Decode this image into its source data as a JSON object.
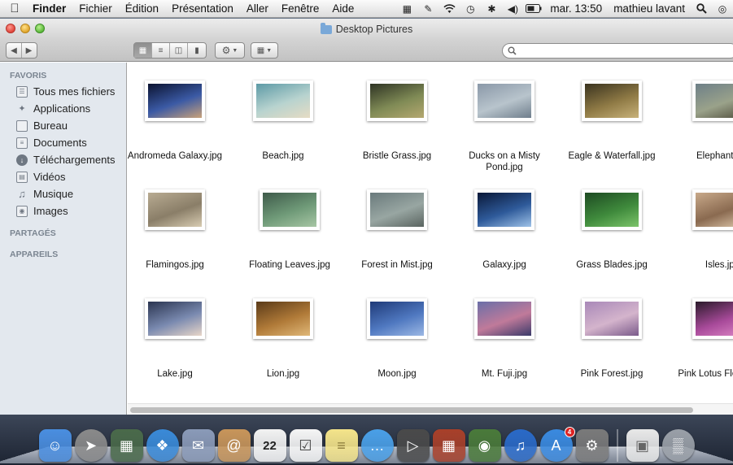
{
  "menubar": {
    "app_name": "Finder",
    "menus": [
      "Fichier",
      "Édition",
      "Présentation",
      "Aller",
      "Fenêtre",
      "Aide"
    ],
    "clock": "mar. 13:50",
    "user": "mathieu lavant",
    "status_icons": [
      "display-icon",
      "script-icon",
      "wifi-icon",
      "time-machine-icon",
      "bluetooth-icon",
      "volume-icon",
      "battery-icon"
    ]
  },
  "window": {
    "title": "Desktop Pictures"
  },
  "search": {
    "placeholder": ""
  },
  "sidebar": {
    "favorites_header": "FAVORIS",
    "favorites": [
      {
        "label": "Tous mes fichiers",
        "icon": "all-files-icon"
      },
      {
        "label": "Applications",
        "icon": "applications-icon"
      },
      {
        "label": "Bureau",
        "icon": "desktop-icon"
      },
      {
        "label": "Documents",
        "icon": "documents-icon"
      },
      {
        "label": "Téléchargements",
        "icon": "downloads-icon"
      },
      {
        "label": "Vidéos",
        "icon": "movies-icon"
      },
      {
        "label": "Musique",
        "icon": "music-icon"
      },
      {
        "label": "Images",
        "icon": "pictures-icon"
      }
    ],
    "shared_header": "PARTAGÉS",
    "devices_header": "APPAREILS"
  },
  "files": [
    {
      "name": "Andromeda Galaxy.jpg",
      "colors": [
        "#0b1330",
        "#3b5aa5",
        "#c9a27a"
      ]
    },
    {
      "name": "Beach.jpg",
      "colors": [
        "#5d9aa6",
        "#b8d3cf",
        "#e6dcc4"
      ]
    },
    {
      "name": "Bristle Grass.jpg",
      "colors": [
        "#2f3424",
        "#7f8a55",
        "#b5a870"
      ]
    },
    {
      "name": "Ducks on a Misty Pond.jpg",
      "colors": [
        "#8a98a8",
        "#b8c4cc",
        "#6f7e8c"
      ]
    },
    {
      "name": "Eagle & Waterfall.jpg",
      "colors": [
        "#3a331f",
        "#8f7a45",
        "#c8b27a"
      ]
    },
    {
      "name": "Elephant.jpg",
      "colors": [
        "#6d7f88",
        "#9aa28a",
        "#4d4a38"
      ]
    },
    {
      "name": "Flamingos.jpg",
      "colors": [
        "#b8ab92",
        "#8a7e68",
        "#d8ccb2"
      ]
    },
    {
      "name": "Floating Leaves.jpg",
      "colors": [
        "#3e5a4a",
        "#6f9a78",
        "#a7c6a4"
      ]
    },
    {
      "name": "Forest in Mist.jpg",
      "colors": [
        "#6a7a7c",
        "#98a6a2",
        "#5a6460"
      ]
    },
    {
      "name": "Galaxy.jpg",
      "colors": [
        "#0a1838",
        "#2e5a9a",
        "#9ec2e8"
      ]
    },
    {
      "name": "Grass Blades.jpg",
      "colors": [
        "#1d4a22",
        "#3f8a3c",
        "#7cc46a"
      ]
    },
    {
      "name": "Isles.jpg",
      "colors": [
        "#c8a98a",
        "#8a6a50",
        "#e2ccb0"
      ]
    },
    {
      "name": "Lake.jpg",
      "colors": [
        "#2a3450",
        "#7a8ab0",
        "#e8d6c8"
      ]
    },
    {
      "name": "Lion.jpg",
      "colors": [
        "#5a3a18",
        "#b07a38",
        "#e0b878"
      ]
    },
    {
      "name": "Moon.jpg",
      "colors": [
        "#1f3a78",
        "#4f78c0",
        "#9cb8e4"
      ]
    },
    {
      "name": "Mt. Fuji.jpg",
      "colors": [
        "#6a6fa8",
        "#c07a9a",
        "#3a3a6a"
      ]
    },
    {
      "name": "Pink Forest.jpg",
      "colors": [
        "#a888b8",
        "#d4b4cc",
        "#7a5a8a"
      ]
    },
    {
      "name": "Pink Lotus Flower.jpg",
      "colors": [
        "#2a1a2a",
        "#a84a9a",
        "#e08ac8"
      ]
    }
  ],
  "dock": {
    "items": [
      {
        "name": "finder",
        "icon": "finder-icon",
        "color": "#4a8ee0"
      },
      {
        "name": "launchpad",
        "icon": "launchpad-icon",
        "color": "#8a8a8a"
      },
      {
        "name": "mission-control",
        "icon": "mission-control-icon",
        "color": "#4a6a4a"
      },
      {
        "name": "safari",
        "icon": "safari-icon",
        "color": "#3a8ad8"
      },
      {
        "name": "mail",
        "icon": "mail-icon",
        "color": "#8a9ab8"
      },
      {
        "name": "contacts",
        "icon": "contacts-icon",
        "color": "#c8955a"
      },
      {
        "name": "calendar",
        "icon": "calendar-icon",
        "color": "#f2f2f2",
        "date": "22"
      },
      {
        "name": "reminders",
        "icon": "reminders-icon",
        "color": "#f5f5f5"
      },
      {
        "name": "notes",
        "icon": "notes-icon",
        "color": "#f4e48a"
      },
      {
        "name": "messages",
        "icon": "messages-icon",
        "color": "#4aa0e8"
      },
      {
        "name": "facetime",
        "icon": "facetime-icon",
        "color": "#4a4a4a"
      },
      {
        "name": "photo-booth",
        "icon": "photo-booth-icon",
        "color": "#a8402a"
      },
      {
        "name": "iphoto",
        "icon": "iphoto-icon",
        "color": "#4a7a3a"
      },
      {
        "name": "itunes",
        "icon": "itunes-icon",
        "color": "#2a6ac8"
      },
      {
        "name": "app-store",
        "icon": "app-store-icon",
        "color": "#3a8ae0",
        "badge": "4"
      },
      {
        "name": "system-preferences",
        "icon": "system-preferences-icon",
        "color": "#7a7a7a"
      }
    ],
    "right_items": [
      {
        "name": "documents-stack",
        "icon": "document-stack-icon",
        "color": "#e8e8e8"
      },
      {
        "name": "trash",
        "icon": "trash-icon",
        "color": "#9aa0a8"
      }
    ]
  }
}
